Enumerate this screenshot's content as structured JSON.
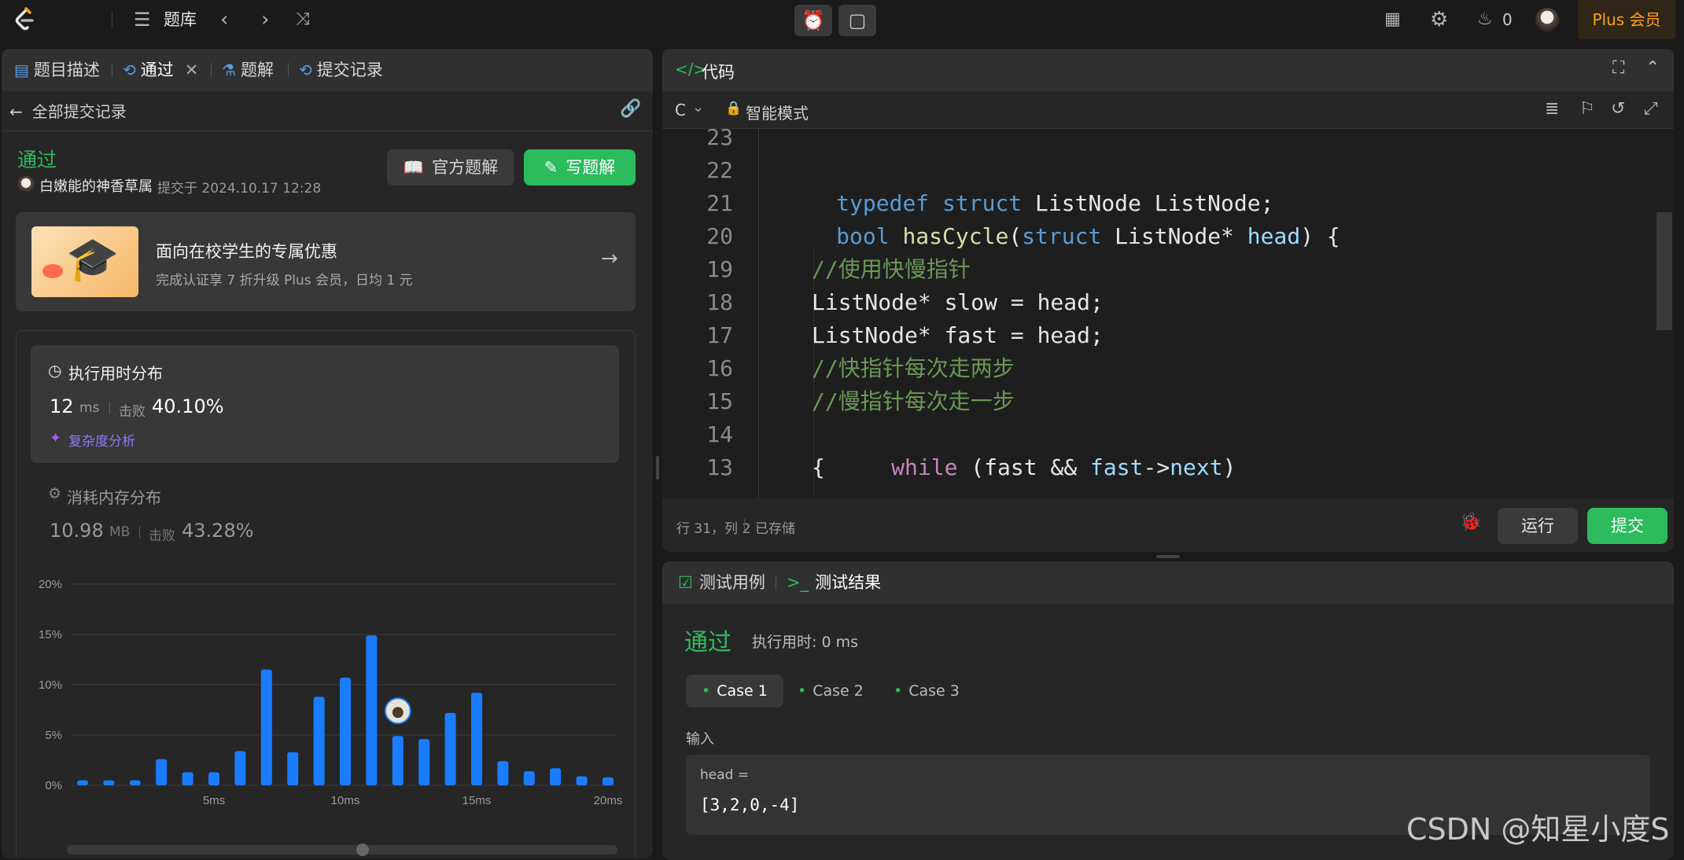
{
  "topbar": {
    "problem_bank": "题库",
    "streak_count": "0",
    "plus_label": "Plus 会员"
  },
  "left_tabs": {
    "description": "题目描述",
    "accepted": "通过",
    "solutions": "题解",
    "submissions": "提交记录"
  },
  "left": {
    "back_label": "全部提交记录",
    "status": "通过",
    "user": "白嫩能的神香草属",
    "submitted_at": "提交于 2024.10.17 12:28",
    "official_solution_btn": "官方题解",
    "write_solution_btn": "写题解",
    "promo_title": "面向在校学生的专属优惠",
    "promo_sub": "完成认证享 7 折升级 Plus 会员，日均 1 元",
    "runtime_title": "执行用时分布",
    "runtime_value": "12",
    "runtime_unit": "ms",
    "beats_label": "击败",
    "runtime_beats": "40.10%",
    "complexity_link": "复杂度分析",
    "memory_title": "消耗内存分布",
    "memory_value": "10.98",
    "memory_unit": "MB",
    "memory_beats": "43.28%"
  },
  "chart_data": {
    "type": "bar",
    "title": "",
    "xlabel": "",
    "ylabel": "",
    "x_ticks": [
      "5ms",
      "10ms",
      "15ms",
      "20ms"
    ],
    "y_ticks": [
      "20%",
      "15%",
      "10%",
      "5%",
      "0%"
    ],
    "ylim": [
      0,
      20
    ],
    "values": [
      0.5,
      0.5,
      0.5,
      2.6,
      1.3,
      1.3,
      3.4,
      11.5,
      3.3,
      8.8,
      10.7,
      14.9,
      4.9,
      4.6,
      7.2,
      9.2,
      2.4,
      1.4,
      1.7,
      0.9,
      0.8
    ],
    "highlight_index": 12,
    "color": "#1a7cff"
  },
  "code_panel": {
    "title": "代码",
    "language": "C",
    "mode": "智能模式",
    "line_numbers": [
      "23",
      "22",
      "21",
      "20",
      "19",
      "18",
      "17",
      "16",
      "15",
      "14",
      "13"
    ],
    "status_position": "行 31，列 2",
    "status_saved": "已存储",
    "run_btn": "运行",
    "submit_btn": "提交"
  },
  "code": {
    "l22_kw": "typedef struct",
    "l22_rest": " ListNode ListNode;",
    "l21_kw": "bool",
    "l21_fn": "hasCycle",
    "l21_open": "(",
    "l21_kw2": "struct",
    "l21_type": " ListNode* ",
    "l21_var": "head",
    "l21_close": ") {",
    "l19": "//使用快慢指针",
    "l18": "ListNode* slow = head;",
    "l17": "ListNode* fast = head;",
    "l16": "//快指针每次走两步",
    "l15": "//慢指针每次走一步",
    "l14_kw": "while",
    "l14_a": " (fast && ",
    "l14_var": "fast",
    "l14_arrow": "->",
    "l14_field": "next",
    "l14_end": ")",
    "l13": "{"
  },
  "test_panel": {
    "tab_cases": "测试用例",
    "tab_results": "测试结果",
    "status": "通过",
    "runtime": "执行用时: 0 ms",
    "cases": [
      "Case 1",
      "Case 2",
      "Case 3"
    ],
    "input_label": "输入",
    "param_name": "head =",
    "param_value": "[3,2,0,-4]"
  },
  "watermark": "CSDN @知星小度S"
}
